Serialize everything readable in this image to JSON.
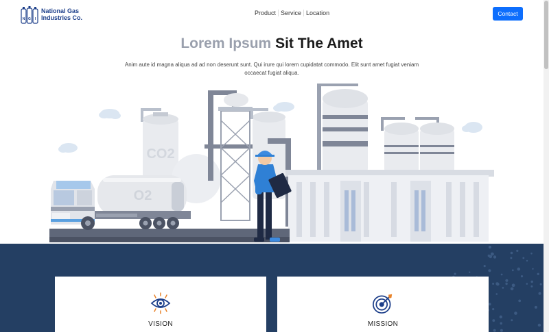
{
  "nav": {
    "brand": {
      "line1": "National Gas",
      "line2": "Industries Co."
    },
    "links": [
      "Product",
      "Service",
      "Location"
    ],
    "contact_label": "Contact"
  },
  "hero": {
    "title_muted": "Lorem Ipsum",
    "title_dark": "Sit The Amet",
    "description": "Anim aute id magna aliqua ad ad non deserunt sunt. Qui irure qui lorem cupidatat commodo. Elit sunt amet fugiat veniam occaecat fugiat aliqua.",
    "tank_labels": [
      "CO2",
      "O2"
    ]
  },
  "cards": [
    {
      "title": "VISION",
      "icon": "eye-icon"
    },
    {
      "title": "MISSION",
      "icon": "target-icon"
    }
  ],
  "colors": {
    "brand": "#1d3f8a",
    "accent": "#0d6efd",
    "band": "#243f63",
    "muted_title": "#9aa0ad"
  }
}
